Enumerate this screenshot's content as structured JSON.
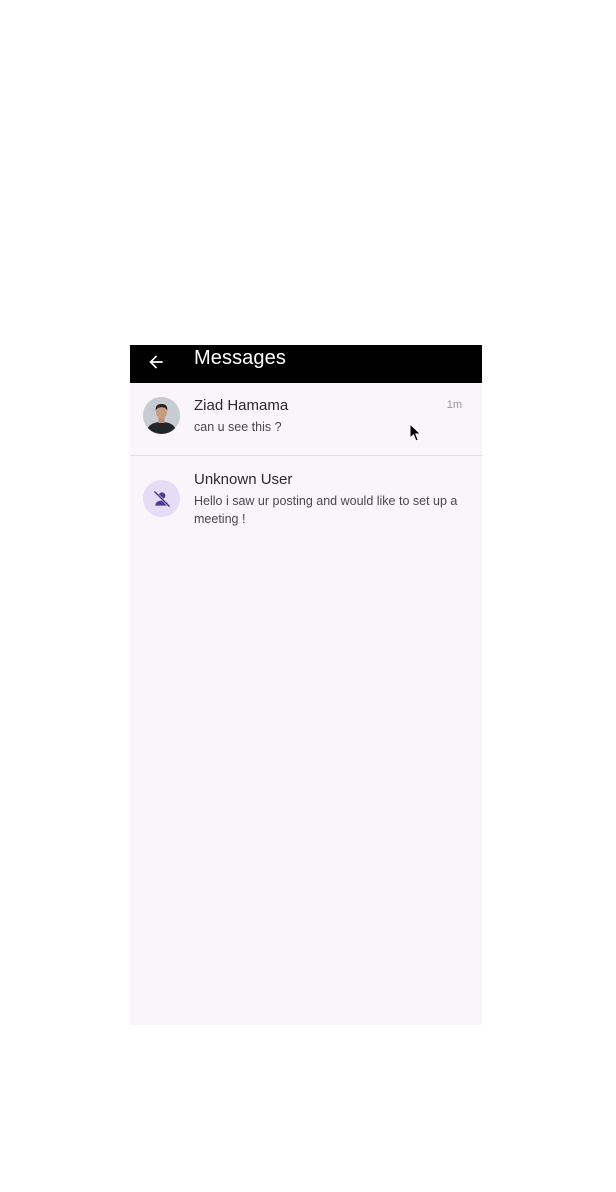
{
  "appbar": {
    "title": "Messages",
    "back_icon": "arrow-left-icon"
  },
  "conversations": [
    {
      "name": "Ziad Hamama",
      "preview": "can u see this ?",
      "time": "1m",
      "avatar": "profile-photo"
    },
    {
      "name": "Unknown User",
      "preview": "Hello i saw ur posting and would like to set up a meeting !",
      "time": "",
      "avatar": "unknown-user-icon"
    }
  ],
  "colors": {
    "appbar_bg": "#000000",
    "page_bg": "#faf5fb",
    "avatar_tint": "#e6dcf5",
    "icon_accent": "#4b3a8f"
  }
}
